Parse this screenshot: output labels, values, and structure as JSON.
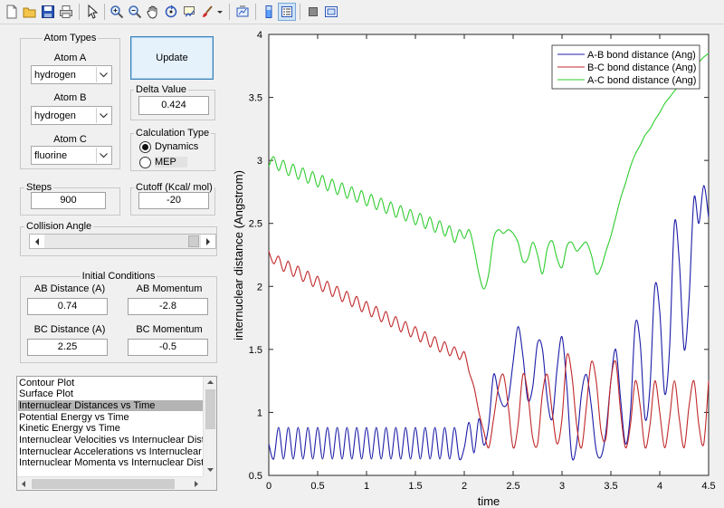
{
  "toolbar": {
    "items": [
      {
        "icon": "new-file-icon"
      },
      {
        "icon": "open-folder-icon"
      },
      {
        "icon": "save-icon"
      },
      {
        "icon": "print-icon"
      },
      {
        "icon": "pointer-icon"
      },
      {
        "icon": "zoom-in-icon"
      },
      {
        "icon": "zoom-out-icon"
      },
      {
        "icon": "pan-hand-icon"
      },
      {
        "icon": "rotate-3d-icon"
      },
      {
        "icon": "data-cursor-icon"
      },
      {
        "icon": "brush-icon"
      },
      {
        "icon": "link-plot-icon"
      },
      {
        "icon": "colorbar-icon"
      },
      {
        "icon": "legend-icon"
      },
      {
        "icon": "hide-plot-tools-icon"
      },
      {
        "icon": "show-plot-tools-icon"
      }
    ]
  },
  "atom_types": {
    "title": "Atom Types",
    "atom_a": {
      "label": "Atom A",
      "value": "hydrogen"
    },
    "atom_b": {
      "label": "Atom B",
      "value": "hydrogen"
    },
    "atom_c": {
      "label": "Atom C",
      "value": "fluorine"
    }
  },
  "update_button": {
    "label": "Update"
  },
  "delta": {
    "title": "Delta Value",
    "value": "0.424"
  },
  "calc_type": {
    "title": "Calculation Type",
    "options": [
      "Dynamics",
      "MEP"
    ],
    "selected": "Dynamics"
  },
  "steps": {
    "title": "Steps",
    "value": "900"
  },
  "cutoff": {
    "title": "Cutoff (Kcal/ mol)",
    "value": "-20"
  },
  "collision": {
    "title": "Collision Angle"
  },
  "initial": {
    "title": "Initial Conditions",
    "ab_distance": {
      "label": "AB Distance (A)",
      "value": "0.74"
    },
    "ab_momentum": {
      "label": "AB Momentum",
      "value": "-2.8"
    },
    "bc_distance": {
      "label": "BC Distance (A)",
      "value": "2.25"
    },
    "bc_momentum": {
      "label": "BC Momentum",
      "value": "-0.5"
    }
  },
  "plot_list": {
    "items": [
      "Contour Plot",
      "Surface Plot",
      "Internuclear Distances vs Time",
      "Potential Energy vs Time",
      "Kinetic Energy vs Time",
      "Internuclear Velocities vs Internuclear Distances",
      "Internuclear Accelerations vs Internuclear Distances",
      "Internuclear Momenta vs Internuclear Distances"
    ],
    "selected_index": 2
  },
  "chart_data": {
    "type": "line",
    "xlabel": "time",
    "ylabel": "internuclear distance (Angstrom)",
    "xlim": [
      0,
      4.5
    ],
    "ylim": [
      0.5,
      4
    ],
    "xticks": [
      "0",
      "0.5",
      "1",
      "1.5",
      "2",
      "2.5",
      "3",
      "3.5",
      "4",
      "4.5"
    ],
    "yticks": [
      "0.5",
      "1",
      "1.5",
      "2",
      "2.5",
      "3",
      "3.5",
      "4"
    ],
    "legend_position": "top-right",
    "series": [
      {
        "name": "A-B bond distance (Ang)",
        "color": "#1c1ca8",
        "x": [
          0,
          0.05,
          0.1,
          0.15,
          0.2,
          0.25,
          0.3,
          0.35,
          0.4,
          0.45,
          0.5,
          0.55,
          0.6,
          0.65,
          0.7,
          0.75,
          0.8,
          0.85,
          0.9,
          0.95,
          1.0,
          1.05,
          1.1,
          1.15,
          1.2,
          1.25,
          1.3,
          1.35,
          1.4,
          1.45,
          1.5,
          1.55,
          1.6,
          1.65,
          1.7,
          1.75,
          1.8,
          1.85,
          1.9,
          1.95,
          2.0,
          2.05,
          2.1,
          2.15,
          2.2,
          2.25,
          2.3,
          2.35,
          2.4,
          2.45,
          2.5,
          2.55,
          2.6,
          2.65,
          2.7,
          2.75,
          2.8,
          2.85,
          2.9,
          2.95,
          3.0,
          3.05,
          3.1,
          3.15,
          3.2,
          3.25,
          3.3,
          3.35,
          3.4,
          3.45,
          3.5,
          3.55,
          3.6,
          3.65,
          3.7,
          3.75,
          3.8,
          3.85,
          3.9,
          3.95,
          4.0,
          4.05,
          4.1,
          4.15,
          4.2,
          4.25,
          4.3,
          4.35,
          4.4,
          4.45,
          4.5
        ],
        "y": [
          0.75,
          0.63,
          0.88,
          0.63,
          0.88,
          0.63,
          0.88,
          0.63,
          0.88,
          0.63,
          0.88,
          0.63,
          0.88,
          0.63,
          0.88,
          0.63,
          0.88,
          0.63,
          0.88,
          0.63,
          0.88,
          0.63,
          0.88,
          0.63,
          0.88,
          0.63,
          0.88,
          0.63,
          0.88,
          0.63,
          0.88,
          0.63,
          0.88,
          0.63,
          0.88,
          0.63,
          0.88,
          0.63,
          0.88,
          0.63,
          0.72,
          0.92,
          0.68,
          0.95,
          0.74,
          0.9,
          1.3,
          1.15,
          1.05,
          1.1,
          1.4,
          1.68,
          1.45,
          1.1,
          1.2,
          1.55,
          1.5,
          1.1,
          0.95,
          1.35,
          1.6,
          1.2,
          0.65,
          0.75,
          1.15,
          1.3,
          1.05,
          0.7,
          0.65,
          0.85,
          1.25,
          1.5,
          1.1,
          0.75,
          1.0,
          1.7,
          1.55,
          0.95,
          1.2,
          2.0,
          1.8,
          1.15,
          1.5,
          2.5,
          2.2,
          1.5,
          1.9,
          2.7,
          2.5,
          2.8,
          2.55
        ]
      },
      {
        "name": "B-C bond distance (Ang)",
        "color": "#c0282a",
        "x": [
          0,
          0.05,
          0.1,
          0.15,
          0.2,
          0.25,
          0.3,
          0.35,
          0.4,
          0.45,
          0.5,
          0.55,
          0.6,
          0.65,
          0.7,
          0.75,
          0.8,
          0.85,
          0.9,
          0.95,
          1.0,
          1.05,
          1.1,
          1.15,
          1.2,
          1.25,
          1.3,
          1.35,
          1.4,
          1.45,
          1.5,
          1.55,
          1.6,
          1.65,
          1.7,
          1.75,
          1.8,
          1.85,
          1.9,
          1.95,
          2.0,
          2.05,
          2.1,
          2.15,
          2.2,
          2.25,
          2.3,
          2.35,
          2.4,
          2.45,
          2.5,
          2.55,
          2.6,
          2.65,
          2.7,
          2.75,
          2.8,
          2.85,
          2.9,
          2.95,
          3.0,
          3.05,
          3.1,
          3.15,
          3.2,
          3.25,
          3.3,
          3.35,
          3.4,
          3.45,
          3.5,
          3.55,
          3.6,
          3.65,
          3.7,
          3.75,
          3.8,
          3.85,
          3.9,
          3.95,
          4.0,
          4.05,
          4.1,
          4.15,
          4.2,
          4.25,
          4.3,
          4.35,
          4.4,
          4.45,
          4.5
        ],
        "y": [
          2.28,
          2.18,
          2.24,
          2.12,
          2.2,
          2.08,
          2.16,
          2.04,
          2.12,
          2.0,
          2.08,
          1.96,
          2.04,
          1.92,
          2.0,
          1.88,
          1.96,
          1.84,
          1.92,
          1.8,
          1.88,
          1.76,
          1.84,
          1.72,
          1.8,
          1.68,
          1.76,
          1.64,
          1.72,
          1.6,
          1.68,
          1.56,
          1.64,
          1.52,
          1.6,
          1.48,
          1.56,
          1.45,
          1.52,
          1.42,
          1.48,
          1.32,
          1.2,
          1.0,
          0.85,
          0.72,
          0.95,
          1.2,
          1.3,
          1.05,
          0.72,
          0.9,
          1.3,
          1.15,
          0.8,
          0.75,
          1.15,
          1.3,
          1.0,
          0.75,
          0.95,
          1.45,
          1.3,
          0.9,
          0.72,
          1.05,
          1.4,
          1.25,
          0.85,
          0.8,
          1.25,
          1.4,
          1.0,
          0.72,
          0.9,
          1.25,
          1.05,
          0.72,
          0.9,
          1.25,
          1.0,
          0.72,
          0.95,
          1.25,
          0.95,
          0.72,
          1.05,
          1.25,
          0.9,
          0.75,
          1.25
        ]
      },
      {
        "name": "A-C bond distance (Ang)",
        "color": "#2ecc2e",
        "x": [
          0,
          0.05,
          0.1,
          0.15,
          0.2,
          0.25,
          0.3,
          0.35,
          0.4,
          0.45,
          0.5,
          0.55,
          0.6,
          0.65,
          0.7,
          0.75,
          0.8,
          0.85,
          0.9,
          0.95,
          1.0,
          1.05,
          1.1,
          1.15,
          1.2,
          1.25,
          1.3,
          1.35,
          1.4,
          1.45,
          1.5,
          1.55,
          1.6,
          1.65,
          1.7,
          1.75,
          1.8,
          1.85,
          1.9,
          1.95,
          2.0,
          2.05,
          2.1,
          2.15,
          2.2,
          2.25,
          2.3,
          2.35,
          2.4,
          2.45,
          2.5,
          2.55,
          2.6,
          2.65,
          2.7,
          2.75,
          2.8,
          2.85,
          2.9,
          2.95,
          3.0,
          3.05,
          3.1,
          3.15,
          3.2,
          3.25,
          3.3,
          3.35,
          3.4,
          3.45,
          3.5,
          3.55,
          3.6,
          3.65,
          3.7,
          3.75,
          3.8,
          3.85,
          3.9,
          3.95,
          4.0,
          4.05,
          4.1,
          4.15,
          4.2,
          4.25,
          4.3,
          4.35,
          4.4,
          4.45,
          4.5
        ],
        "y": [
          2.95,
          3.03,
          2.92,
          3.0,
          2.88,
          2.97,
          2.85,
          2.94,
          2.82,
          2.91,
          2.79,
          2.88,
          2.76,
          2.85,
          2.73,
          2.82,
          2.7,
          2.79,
          2.67,
          2.76,
          2.64,
          2.73,
          2.61,
          2.7,
          2.58,
          2.67,
          2.55,
          2.64,
          2.52,
          2.61,
          2.49,
          2.58,
          2.46,
          2.55,
          2.43,
          2.52,
          2.4,
          2.48,
          2.35,
          2.45,
          2.38,
          2.45,
          2.3,
          2.1,
          1.98,
          2.1,
          2.38,
          2.45,
          2.42,
          2.45,
          2.42,
          2.35,
          2.2,
          2.22,
          2.35,
          2.25,
          2.1,
          2.3,
          2.36,
          2.22,
          2.15,
          2.32,
          2.35,
          2.28,
          2.32,
          2.35,
          2.25,
          2.1,
          2.15,
          2.28,
          2.4,
          2.55,
          2.7,
          2.82,
          2.95,
          3.05,
          3.12,
          3.2,
          3.25,
          3.32,
          3.38,
          3.45,
          3.5,
          3.55,
          3.6,
          3.65,
          3.7,
          3.75,
          3.78,
          3.82,
          3.85
        ]
      }
    ]
  }
}
